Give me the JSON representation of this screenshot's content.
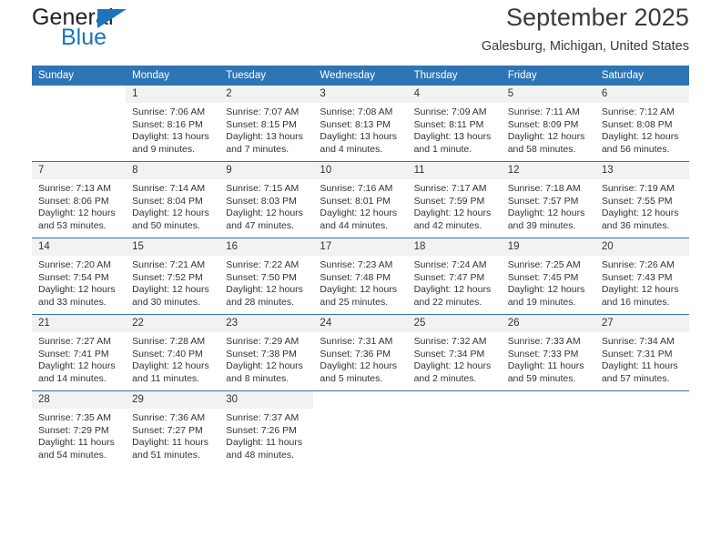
{
  "brand": {
    "name_part1": "General",
    "name_part2": "Blue",
    "accent_color": "#1c75bc"
  },
  "header": {
    "title": "September 2025",
    "subtitle": "Galesburg, Michigan, United States"
  },
  "calendar": {
    "header_color": "#2e75b6",
    "daynum_bg": "#f2f2f2",
    "weekdays": [
      "Sunday",
      "Monday",
      "Tuesday",
      "Wednesday",
      "Thursday",
      "Friday",
      "Saturday"
    ],
    "weeks": [
      [
        {
          "day": "",
          "sunrise": "",
          "sunset": "",
          "daylight1": "",
          "daylight2": ""
        },
        {
          "day": "1",
          "sunrise": "Sunrise: 7:06 AM",
          "sunset": "Sunset: 8:16 PM",
          "daylight1": "Daylight: 13 hours",
          "daylight2": "and 9 minutes."
        },
        {
          "day": "2",
          "sunrise": "Sunrise: 7:07 AM",
          "sunset": "Sunset: 8:15 PM",
          "daylight1": "Daylight: 13 hours",
          "daylight2": "and 7 minutes."
        },
        {
          "day": "3",
          "sunrise": "Sunrise: 7:08 AM",
          "sunset": "Sunset: 8:13 PM",
          "daylight1": "Daylight: 13 hours",
          "daylight2": "and 4 minutes."
        },
        {
          "day": "4",
          "sunrise": "Sunrise: 7:09 AM",
          "sunset": "Sunset: 8:11 PM",
          "daylight1": "Daylight: 13 hours",
          "daylight2": "and 1 minute."
        },
        {
          "day": "5",
          "sunrise": "Sunrise: 7:11 AM",
          "sunset": "Sunset: 8:09 PM",
          "daylight1": "Daylight: 12 hours",
          "daylight2": "and 58 minutes."
        },
        {
          "day": "6",
          "sunrise": "Sunrise: 7:12 AM",
          "sunset": "Sunset: 8:08 PM",
          "daylight1": "Daylight: 12 hours",
          "daylight2": "and 56 minutes."
        }
      ],
      [
        {
          "day": "7",
          "sunrise": "Sunrise: 7:13 AM",
          "sunset": "Sunset: 8:06 PM",
          "daylight1": "Daylight: 12 hours",
          "daylight2": "and 53 minutes."
        },
        {
          "day": "8",
          "sunrise": "Sunrise: 7:14 AM",
          "sunset": "Sunset: 8:04 PM",
          "daylight1": "Daylight: 12 hours",
          "daylight2": "and 50 minutes."
        },
        {
          "day": "9",
          "sunrise": "Sunrise: 7:15 AM",
          "sunset": "Sunset: 8:03 PM",
          "daylight1": "Daylight: 12 hours",
          "daylight2": "and 47 minutes."
        },
        {
          "day": "10",
          "sunrise": "Sunrise: 7:16 AM",
          "sunset": "Sunset: 8:01 PM",
          "daylight1": "Daylight: 12 hours",
          "daylight2": "and 44 minutes."
        },
        {
          "day": "11",
          "sunrise": "Sunrise: 7:17 AM",
          "sunset": "Sunset: 7:59 PM",
          "daylight1": "Daylight: 12 hours",
          "daylight2": "and 42 minutes."
        },
        {
          "day": "12",
          "sunrise": "Sunrise: 7:18 AM",
          "sunset": "Sunset: 7:57 PM",
          "daylight1": "Daylight: 12 hours",
          "daylight2": "and 39 minutes."
        },
        {
          "day": "13",
          "sunrise": "Sunrise: 7:19 AM",
          "sunset": "Sunset: 7:55 PM",
          "daylight1": "Daylight: 12 hours",
          "daylight2": "and 36 minutes."
        }
      ],
      [
        {
          "day": "14",
          "sunrise": "Sunrise: 7:20 AM",
          "sunset": "Sunset: 7:54 PM",
          "daylight1": "Daylight: 12 hours",
          "daylight2": "and 33 minutes."
        },
        {
          "day": "15",
          "sunrise": "Sunrise: 7:21 AM",
          "sunset": "Sunset: 7:52 PM",
          "daylight1": "Daylight: 12 hours",
          "daylight2": "and 30 minutes."
        },
        {
          "day": "16",
          "sunrise": "Sunrise: 7:22 AM",
          "sunset": "Sunset: 7:50 PM",
          "daylight1": "Daylight: 12 hours",
          "daylight2": "and 28 minutes."
        },
        {
          "day": "17",
          "sunrise": "Sunrise: 7:23 AM",
          "sunset": "Sunset: 7:48 PM",
          "daylight1": "Daylight: 12 hours",
          "daylight2": "and 25 minutes."
        },
        {
          "day": "18",
          "sunrise": "Sunrise: 7:24 AM",
          "sunset": "Sunset: 7:47 PM",
          "daylight1": "Daylight: 12 hours",
          "daylight2": "and 22 minutes."
        },
        {
          "day": "19",
          "sunrise": "Sunrise: 7:25 AM",
          "sunset": "Sunset: 7:45 PM",
          "daylight1": "Daylight: 12 hours",
          "daylight2": "and 19 minutes."
        },
        {
          "day": "20",
          "sunrise": "Sunrise: 7:26 AM",
          "sunset": "Sunset: 7:43 PM",
          "daylight1": "Daylight: 12 hours",
          "daylight2": "and 16 minutes."
        }
      ],
      [
        {
          "day": "21",
          "sunrise": "Sunrise: 7:27 AM",
          "sunset": "Sunset: 7:41 PM",
          "daylight1": "Daylight: 12 hours",
          "daylight2": "and 14 minutes."
        },
        {
          "day": "22",
          "sunrise": "Sunrise: 7:28 AM",
          "sunset": "Sunset: 7:40 PM",
          "daylight1": "Daylight: 12 hours",
          "daylight2": "and 11 minutes."
        },
        {
          "day": "23",
          "sunrise": "Sunrise: 7:29 AM",
          "sunset": "Sunset: 7:38 PM",
          "daylight1": "Daylight: 12 hours",
          "daylight2": "and 8 minutes."
        },
        {
          "day": "24",
          "sunrise": "Sunrise: 7:31 AM",
          "sunset": "Sunset: 7:36 PM",
          "daylight1": "Daylight: 12 hours",
          "daylight2": "and 5 minutes."
        },
        {
          "day": "25",
          "sunrise": "Sunrise: 7:32 AM",
          "sunset": "Sunset: 7:34 PM",
          "daylight1": "Daylight: 12 hours",
          "daylight2": "and 2 minutes."
        },
        {
          "day": "26",
          "sunrise": "Sunrise: 7:33 AM",
          "sunset": "Sunset: 7:33 PM",
          "daylight1": "Daylight: 11 hours",
          "daylight2": "and 59 minutes."
        },
        {
          "day": "27",
          "sunrise": "Sunrise: 7:34 AM",
          "sunset": "Sunset: 7:31 PM",
          "daylight1": "Daylight: 11 hours",
          "daylight2": "and 57 minutes."
        }
      ],
      [
        {
          "day": "28",
          "sunrise": "Sunrise: 7:35 AM",
          "sunset": "Sunset: 7:29 PM",
          "daylight1": "Daylight: 11 hours",
          "daylight2": "and 54 minutes."
        },
        {
          "day": "29",
          "sunrise": "Sunrise: 7:36 AM",
          "sunset": "Sunset: 7:27 PM",
          "daylight1": "Daylight: 11 hours",
          "daylight2": "and 51 minutes."
        },
        {
          "day": "30",
          "sunrise": "Sunrise: 7:37 AM",
          "sunset": "Sunset: 7:26 PM",
          "daylight1": "Daylight: 11 hours",
          "daylight2": "and 48 minutes."
        },
        {
          "day": "",
          "sunrise": "",
          "sunset": "",
          "daylight1": "",
          "daylight2": ""
        },
        {
          "day": "",
          "sunrise": "",
          "sunset": "",
          "daylight1": "",
          "daylight2": ""
        },
        {
          "day": "",
          "sunrise": "",
          "sunset": "",
          "daylight1": "",
          "daylight2": ""
        },
        {
          "day": "",
          "sunrise": "",
          "sunset": "",
          "daylight1": "",
          "daylight2": ""
        }
      ]
    ]
  }
}
